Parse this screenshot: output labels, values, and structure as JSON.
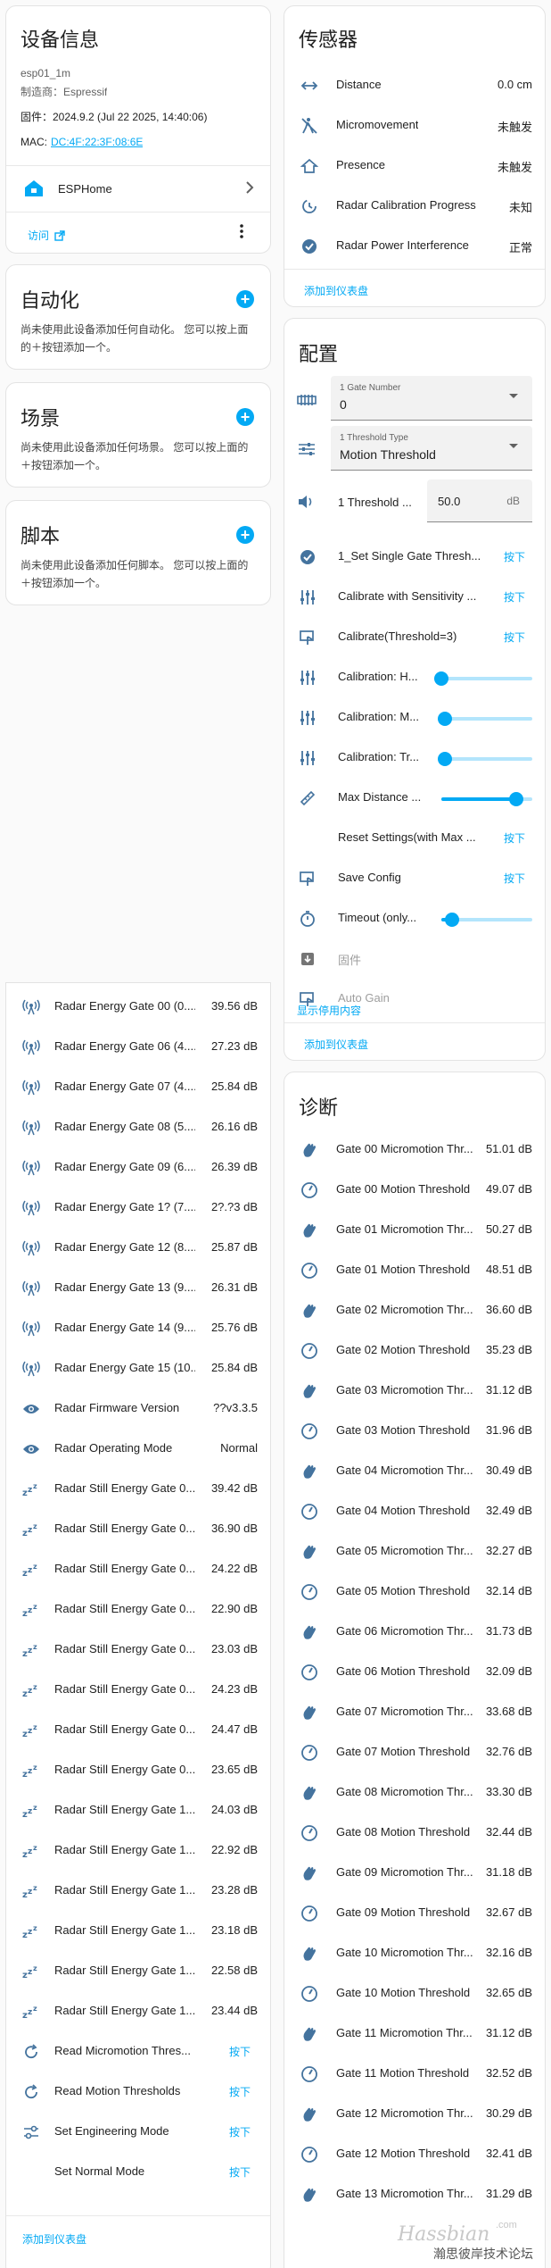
{
  "device_info": {
    "title": "设备信息",
    "model": "esp01_1m",
    "manufacturer": "制造商：Espressif",
    "firmware": "固件：2024.9.2 (Jul 22 2025, 14:40:06)",
    "mac_label": "MAC:",
    "mac_value": "DC:4F:22:3F:08:6E",
    "integration": "ESPHome",
    "visit": "访问"
  },
  "automation": {
    "title": "自动化",
    "desc": "尚未使用此设备添加任何自动化。 您可以按上面的＋按钮添加一个。"
  },
  "scene": {
    "title": "场景",
    "desc": "尚未使用此设备添加任何场景。 您可以按上面的＋按钮添加一个。"
  },
  "script": {
    "title": "脚本",
    "desc": "尚未使用此设备添加任何脚本。 您可以按上面的＋按钮添加一个。"
  },
  "sensors": {
    "title": "传感器",
    "add_to_dashboard": "添加到仪表盘",
    "items": [
      {
        "label": "Distance",
        "value": "0.0 cm",
        "icon": "arrow-left-right-icon"
      },
      {
        "label": "Micromovement",
        "value": "未触发",
        "icon": "motion-sensor-off-icon"
      },
      {
        "label": "Presence",
        "value": "未触发",
        "icon": "home-icon"
      },
      {
        "label": "Radar Calibration Progress",
        "value": "未知",
        "icon": "progress-clock-icon"
      },
      {
        "label": "Radar Power Interference",
        "value": "正常",
        "icon": "check-circle-icon"
      }
    ]
  },
  "config": {
    "title": "配置",
    "add_to_dashboard": "添加到仪表盘",
    "show_disabled": "显示停用内容",
    "gate_number": {
      "label": "1 Gate Number",
      "value": "0"
    },
    "threshold_type": {
      "label": "1 Threshold Type",
      "value": "Motion Threshold"
    },
    "threshold_number": {
      "label": "1 Threshold ...",
      "value": "50.0",
      "unit": "dB"
    },
    "items": [
      {
        "type": "button",
        "label": "1_Set Single Gate Thresh...",
        "action": "按下",
        "icon": "check-circle-icon"
      },
      {
        "type": "button",
        "label": "Calibrate with Sensitivity ...",
        "action": "按下",
        "icon": "tune-vertical-icon"
      },
      {
        "type": "button",
        "label": "Calibrate(Threshold=3)",
        "action": "按下",
        "icon": "gesture-tap-icon"
      },
      {
        "type": "slider",
        "label": "Calibration: H...",
        "level": 0.0,
        "icon": "tune-vertical-icon"
      },
      {
        "type": "slider",
        "label": "Calibration: M...",
        "level": 0.04,
        "icon": "tune-vertical-icon"
      },
      {
        "type": "slider",
        "label": "Calibration: Tr...",
        "level": 0.04,
        "icon": "tune-vertical-icon"
      },
      {
        "type": "slider",
        "label": "Max Distance ...",
        "level": 0.82,
        "icon": "ruler-icon"
      },
      {
        "type": "button",
        "label": "Reset Settings(with Max ...",
        "action": "按下",
        "icon": ""
      },
      {
        "type": "button",
        "label": "Save Config",
        "action": "按下",
        "icon": "gesture-tap-icon"
      },
      {
        "type": "slider",
        "label": "Timeout (only...",
        "level": 0.12,
        "icon": "timer-icon"
      },
      {
        "type": "disabled",
        "label": "固件",
        "icon": "update-icon"
      },
      {
        "type": "disabled",
        "label": "Auto Gain",
        "icon": "gesture-tap-icon"
      }
    ]
  },
  "diagnostics": {
    "title": "诊断",
    "items": [
      {
        "label": "Gate 00 Micromotion Thr...",
        "value": "51.01 dB",
        "icon": "hand-wave-icon"
      },
      {
        "label": "Gate 00 Motion Threshold",
        "value": "49.07 dB",
        "icon": "gauge-icon"
      },
      {
        "label": "Gate 01 Micromotion Thr...",
        "value": "50.27 dB",
        "icon": "hand-wave-icon"
      },
      {
        "label": "Gate 01 Motion Threshold",
        "value": "48.51 dB",
        "icon": "gauge-icon"
      },
      {
        "label": "Gate 02 Micromotion Thr...",
        "value": "36.60 dB",
        "icon": "hand-wave-icon"
      },
      {
        "label": "Gate 02 Motion Threshold",
        "value": "35.23 dB",
        "icon": "gauge-icon"
      },
      {
        "label": "Gate 03 Micromotion Thr...",
        "value": "31.12 dB",
        "icon": "hand-wave-icon"
      },
      {
        "label": "Gate 03 Motion Threshold",
        "value": "31.96 dB",
        "icon": "gauge-icon"
      },
      {
        "label": "Gate 04 Micromotion Thr...",
        "value": "30.49 dB",
        "icon": "hand-wave-icon"
      },
      {
        "label": "Gate 04 Motion Threshold",
        "value": "32.49 dB",
        "icon": "gauge-icon"
      },
      {
        "label": "Gate 05 Micromotion Thr...",
        "value": "32.27 dB",
        "icon": "hand-wave-icon"
      },
      {
        "label": "Gate 05 Motion Threshold",
        "value": "32.14 dB",
        "icon": "gauge-icon"
      },
      {
        "label": "Gate 06 Micromotion Thr...",
        "value": "31.73 dB",
        "icon": "hand-wave-icon"
      },
      {
        "label": "Gate 06 Motion Threshold",
        "value": "32.09 dB",
        "icon": "gauge-icon"
      },
      {
        "label": "Gate 07 Micromotion Thr...",
        "value": "33.68 dB",
        "icon": "hand-wave-icon"
      },
      {
        "label": "Gate 07 Motion Threshold",
        "value": "32.76 dB",
        "icon": "gauge-icon"
      },
      {
        "label": "Gate 08 Micromotion Thr...",
        "value": "33.30 dB",
        "icon": "hand-wave-icon"
      },
      {
        "label": "Gate 08 Motion Threshold",
        "value": "32.44 dB",
        "icon": "gauge-icon"
      },
      {
        "label": "Gate 09 Micromotion Thr...",
        "value": "31.18 dB",
        "icon": "hand-wave-icon"
      },
      {
        "label": "Gate 09 Motion Threshold",
        "value": "32.67 dB",
        "icon": "gauge-icon"
      },
      {
        "label": "Gate 10 Micromotion Thr...",
        "value": "32.16 dB",
        "icon": "hand-wave-icon"
      },
      {
        "label": "Gate 10 Motion Threshold",
        "value": "32.65 dB",
        "icon": "gauge-icon"
      },
      {
        "label": "Gate 11 Micromotion Thr...",
        "value": "31.12 dB",
        "icon": "hand-wave-icon"
      },
      {
        "label": "Gate 11 Motion Threshold",
        "value": "32.52 dB",
        "icon": "gauge-icon"
      },
      {
        "label": "Gate 12 Micromotion Thr...",
        "value": "30.29 dB",
        "icon": "hand-wave-icon"
      },
      {
        "label": "Gate 12 Motion Threshold",
        "value": "32.41 dB",
        "icon": "gauge-icon"
      },
      {
        "label": "Gate 13 Micromotion Thr...",
        "value": "31.29 dB",
        "icon": "hand-wave-icon"
      }
    ]
  },
  "left_list": {
    "add_to_dashboard": "添加到仪表盘",
    "items": [
      {
        "label": "Radar Energy Gate 00 (0....",
        "value": "39.56 dB",
        "icon": "radio-tower-icon"
      },
      {
        "label": "Radar Energy Gate 06 (4....",
        "value": "27.23 dB",
        "icon": "radio-tower-icon"
      },
      {
        "label": "Radar Energy Gate 07 (4....",
        "value": "25.84 dB",
        "icon": "radio-tower-icon"
      },
      {
        "label": "Radar Energy Gate 08 (5....",
        "value": "26.16 dB",
        "icon": "radio-tower-icon"
      },
      {
        "label": "Radar Energy Gate 09 (6....",
        "value": "26.39 dB",
        "icon": "radio-tower-icon"
      },
      {
        "label": "Radar Energy Gate 1? (7....",
        "value": "2?.?3 dB",
        "icon": "radio-tower-icon"
      },
      {
        "label": "Radar Energy Gate 12 (8....",
        "value": "25.87 dB",
        "icon": "radio-tower-icon"
      },
      {
        "label": "Radar Energy Gate 13 (9....",
        "value": "26.31 dB",
        "icon": "radio-tower-icon"
      },
      {
        "label": "Radar Energy Gate 14 (9....",
        "value": "25.76 dB",
        "icon": "radio-tower-icon"
      },
      {
        "label": "Radar Energy Gate 15 (10...",
        "value": "25.84 dB",
        "icon": "radio-tower-icon"
      },
      {
        "label": "Radar Firmware Version",
        "value": "??v3.3.5",
        "icon": "eye-icon"
      },
      {
        "label": "Radar Operating Mode",
        "value": "Normal",
        "icon": "eye-icon"
      },
      {
        "label": "Radar Still Energy Gate 0...",
        "value": "39.42 dB",
        "icon": "sleep-icon"
      },
      {
        "label": "Radar Still Energy Gate 0...",
        "value": "36.90 dB",
        "icon": "sleep-icon"
      },
      {
        "label": "Radar Still Energy Gate 0...",
        "value": "24.22 dB",
        "icon": "sleep-icon"
      },
      {
        "label": "Radar Still Energy Gate 0...",
        "value": "22.90 dB",
        "icon": "sleep-icon"
      },
      {
        "label": "Radar Still Energy Gate 0...",
        "value": "23.03 dB",
        "icon": "sleep-icon"
      },
      {
        "label": "Radar Still Energy Gate 0...",
        "value": "24.23 dB",
        "icon": "sleep-icon"
      },
      {
        "label": "Radar Still Energy Gate 0...",
        "value": "24.47 dB",
        "icon": "sleep-icon"
      },
      {
        "label": "Radar Still Energy Gate 0...",
        "value": "23.65 dB",
        "icon": "sleep-icon"
      },
      {
        "label": "Radar Still Energy Gate 1...",
        "value": "24.03 dB",
        "icon": "sleep-icon"
      },
      {
        "label": "Radar Still Energy Gate 1...",
        "value": "22.92 dB",
        "icon": "sleep-icon"
      },
      {
        "label": "Radar Still Energy Gate 1...",
        "value": "23.28 dB",
        "icon": "sleep-icon"
      },
      {
        "label": "Radar Still Energy Gate 1...",
        "value": "23.18 dB",
        "icon": "sleep-icon"
      },
      {
        "label": "Radar Still Energy Gate 1...",
        "value": "22.58 dB",
        "icon": "sleep-icon"
      },
      {
        "label": "Radar Still Energy Gate 1...",
        "value": "23.44 dB",
        "icon": "sleep-icon"
      }
    ],
    "buttons": [
      {
        "label": "Read Micromotion Thres...",
        "action": "按下",
        "icon": "refresh-icon"
      },
      {
        "label": "Read Motion Thresholds",
        "action": "按下",
        "icon": "refresh-icon"
      },
      {
        "label": "Set Engineering Mode",
        "action": "按下",
        "icon": "tune-icon"
      },
      {
        "label": "Set Normal Mode",
        "action": "按下",
        "icon": ""
      }
    ]
  },
  "watermark": {
    "brand": "Hassbian",
    "sub": ".com",
    "caption": "瀚思彼岸技术论坛"
  }
}
